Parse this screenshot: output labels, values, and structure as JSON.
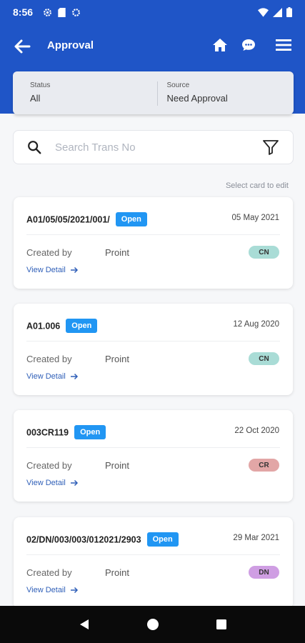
{
  "status_bar": {
    "time": "8:56"
  },
  "header": {
    "title": "Approval"
  },
  "filters": {
    "status": {
      "label": "Status",
      "value": "All"
    },
    "source": {
      "label": "Source",
      "value": "Need Approval"
    }
  },
  "search": {
    "placeholder": "Search Trans No"
  },
  "hint": "Select card to edit",
  "cards": [
    {
      "trans_no": "A01/05/05/2021/001/",
      "status": "Open",
      "date": "05 May 2021",
      "created_by_label": "Created by",
      "created_by": "Proint",
      "type": "CN",
      "type_color": "#a9dcd6",
      "view_label": "View Detail"
    },
    {
      "trans_no": "A01.006",
      "status": "Open",
      "date": "12 Aug 2020",
      "created_by_label": "Created by",
      "created_by": "Proint",
      "type": "CN",
      "type_color": "#a9dcd6",
      "view_label": "View Detail"
    },
    {
      "trans_no": "003CR119",
      "status": "Open",
      "date": "22 Oct 2020",
      "created_by_label": "Created by",
      "created_by": "Proint",
      "type": "CR",
      "type_color": "#e2a6a6",
      "view_label": "View Detail"
    },
    {
      "trans_no": "02/DN/003/003/012021/2903",
      "status": "Open",
      "date": "29 Mar 2021",
      "created_by_label": "Created by",
      "created_by": "Proint",
      "type": "DN",
      "type_color": "#cf9ee3",
      "view_label": "View Detail"
    }
  ],
  "colors": {
    "primary": "#1f55c7",
    "badge": "#2196f3",
    "link": "#2f5fb8"
  }
}
